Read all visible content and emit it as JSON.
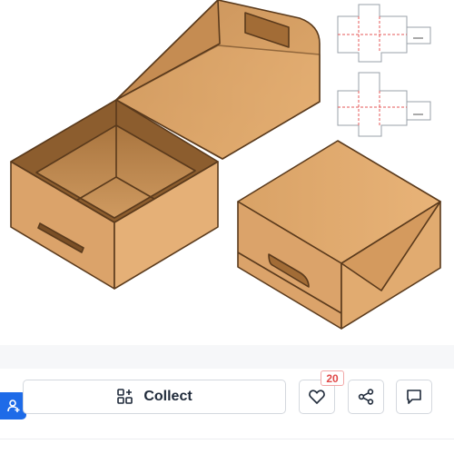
{
  "actions": {
    "collect_label": "Collect",
    "like_count": "20"
  },
  "icons": {
    "collect": "add-to-collection-icon",
    "like": "heart-icon",
    "share": "share-icon",
    "comment": "comment-icon",
    "user": "user-add-icon"
  },
  "colors": {
    "cardboard": "#d49a5e",
    "cardboard_dark": "#b87d44",
    "outline": "#5a3a1c",
    "accent_blue": "#1e6be8",
    "badge_red": "#e04848",
    "dieline_red": "#e45a5a"
  }
}
